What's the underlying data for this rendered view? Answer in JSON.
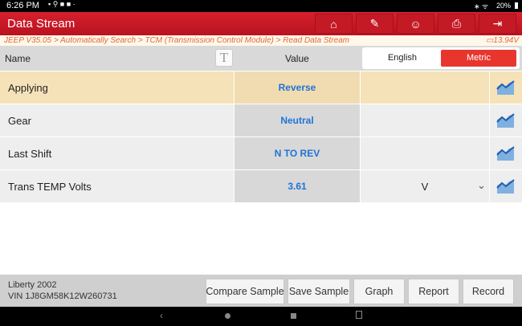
{
  "status": {
    "time": "6:26 PM",
    "battery": "20%"
  },
  "title": "Data Stream",
  "toolbar": [
    "home-icon",
    "edit-report-icon",
    "support-icon",
    "print-icon",
    "exit-icon"
  ],
  "breadcrumb": "JEEP V35.05 > Automatically Search > TCM (Transmission Control Module) > Read Data Stream",
  "voltage": "13.94V",
  "header": {
    "name": "Name",
    "value": "Value",
    "english": "English",
    "metric": "Metric",
    "selected_unit": "Metric"
  },
  "rows": [
    {
      "name": "Applying",
      "value": "Reverse",
      "unit": ""
    },
    {
      "name": "Gear",
      "value": "Neutral",
      "unit": ""
    },
    {
      "name": "Last Shift",
      "value": "N TO REV",
      "unit": ""
    },
    {
      "name": "Trans TEMP Volts",
      "value": "3.61",
      "unit": "V"
    }
  ],
  "vehicle": {
    "model": "Liberty 2002",
    "vin": "VIN 1J8GM58K12W260731"
  },
  "buttons": {
    "compare": "Compare Sample",
    "save": "Save Sample",
    "graph": "Graph",
    "report": "Report",
    "record": "Record"
  },
  "colors": {
    "accent": "#d01e2b",
    "value": "#1e74d8",
    "selected_row": "#f6e2b8"
  }
}
